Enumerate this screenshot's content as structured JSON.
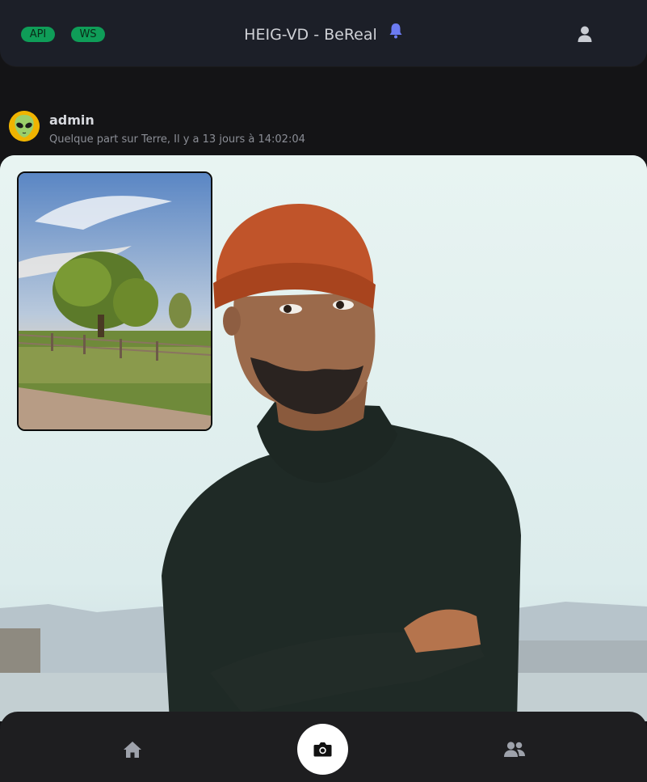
{
  "header": {
    "badges": [
      {
        "label": "API",
        "color": "#0f9d58"
      },
      {
        "label": "WS",
        "color": "#0f9d58"
      }
    ],
    "title": "HEIG-VD - BeReal",
    "bell_icon": "bell-icon",
    "user_icon": "user-icon"
  },
  "post": {
    "username": "admin",
    "meta": "Quelque part sur Terre, Il y a 13 jours à 14:02:04",
    "avatar_icon": "alien-avatar",
    "main_photo": "person-in-orange-beanie-photo",
    "secondary_photo": "tree-landscape-photo"
  },
  "bottom_nav": {
    "items": [
      {
        "icon": "home-icon"
      },
      {
        "icon": "camera-icon"
      },
      {
        "icon": "friends-icon"
      }
    ]
  },
  "colors": {
    "accent": "#6c7bf2",
    "badge": "#0f9d58",
    "background": "#141416",
    "header": "#1c1f28"
  }
}
